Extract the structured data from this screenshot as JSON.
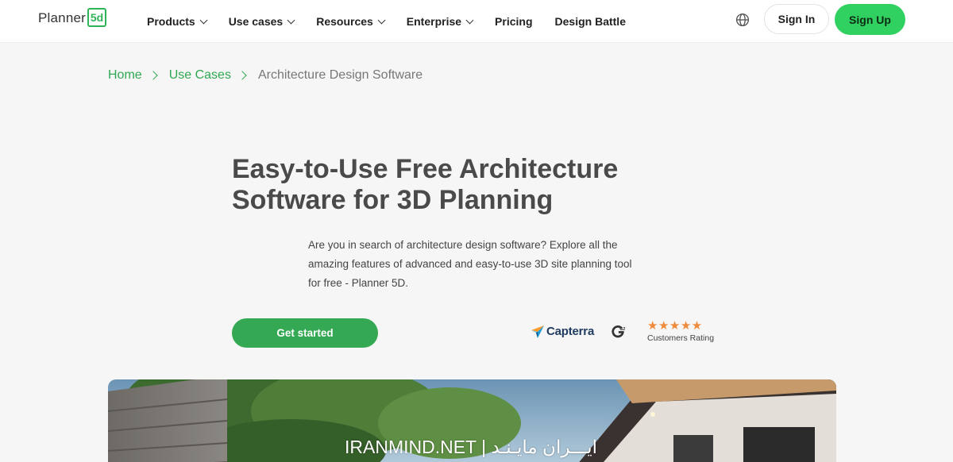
{
  "header": {
    "logo_text": "Planner",
    "logo_badge": "5d",
    "nav": [
      {
        "label": "Products",
        "has_dropdown": true
      },
      {
        "label": "Use cases",
        "has_dropdown": true
      },
      {
        "label": "Resources",
        "has_dropdown": true
      },
      {
        "label": "Enterprise",
        "has_dropdown": true
      },
      {
        "label": "Pricing",
        "has_dropdown": false
      },
      {
        "label": "Design Battle",
        "has_dropdown": false
      }
    ],
    "language_icon": "globe-icon",
    "signin_label": "Sign In",
    "signup_label": "Sign Up"
  },
  "breadcrumb": {
    "items": [
      "Home",
      "Use Cases"
    ],
    "current": "Architecture Design Software"
  },
  "hero": {
    "title": "Easy-to-Use Free Architecture Software for 3D Planning",
    "description": "Are you in search of architecture design software? Explore all the amazing features of advanced and easy-to-use 3D site planning tool for free - Planner 5D.",
    "cta_label": "Get started"
  },
  "ratings": {
    "capterra_label": "Capterra",
    "g2_label": "G2",
    "stars": "★★★★★",
    "rating_value": 4.5,
    "rating_caption": "Customers Rating"
  },
  "watermark": "IRANMIND.NET | ایـــران مایـنـد",
  "colors": {
    "brand_green": "#30d160",
    "cta_green": "#34a853",
    "link_green": "#2fa851",
    "star_orange": "#ef8a3a",
    "title_gray": "#4a4a4a"
  }
}
